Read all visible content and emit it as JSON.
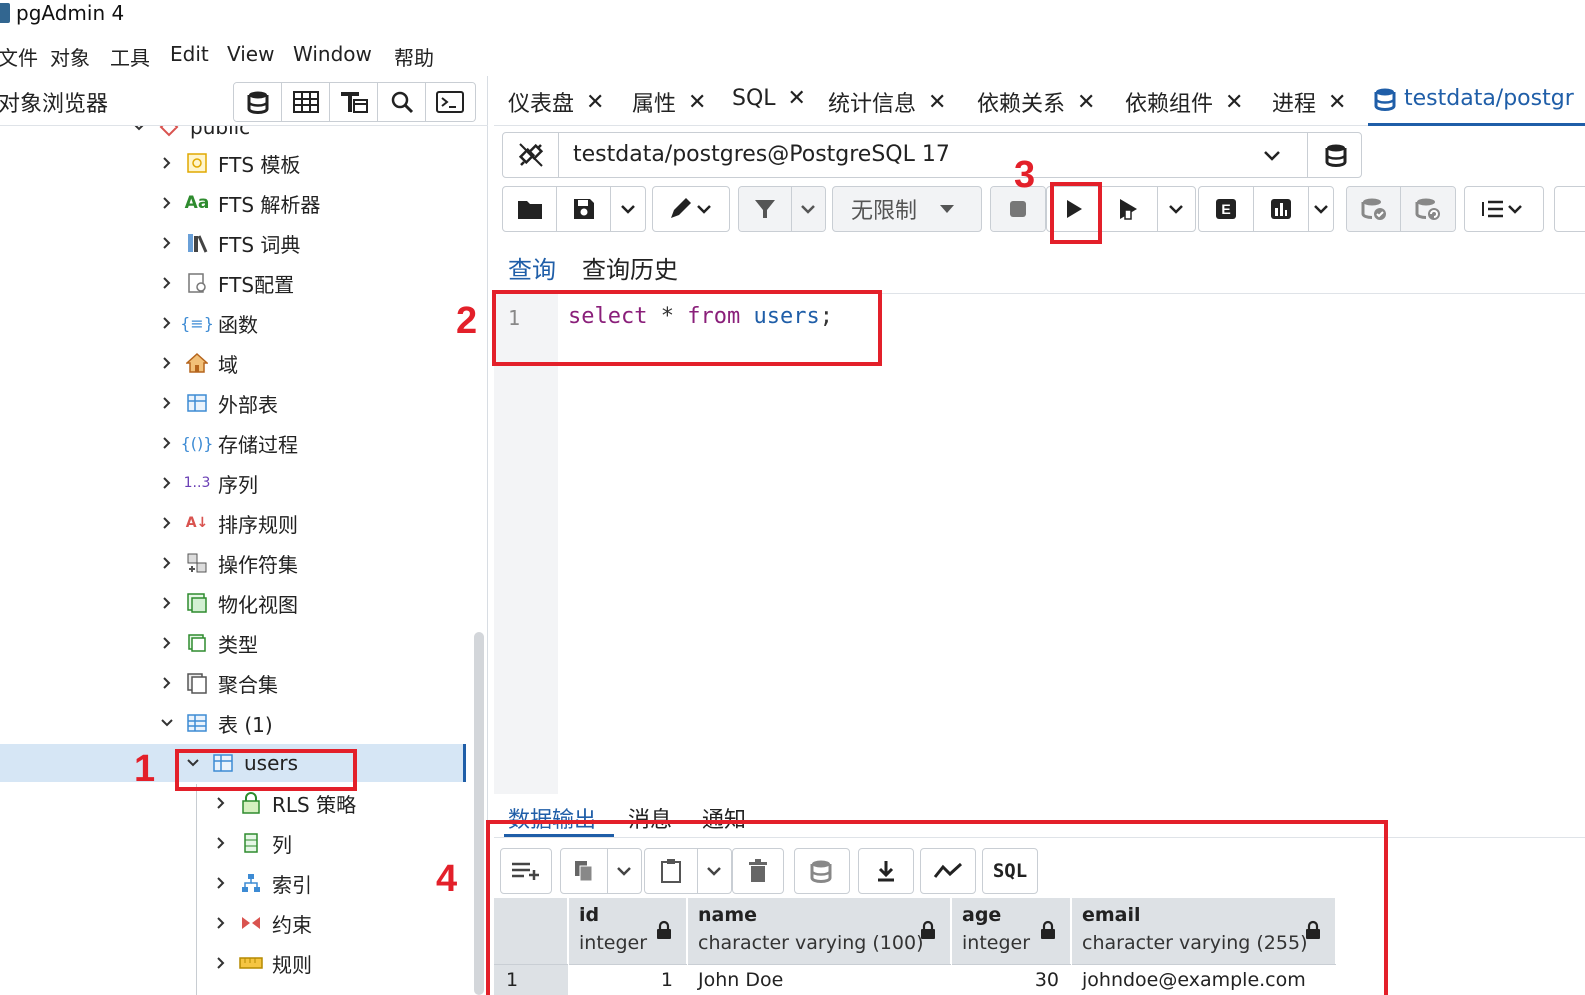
{
  "app": {
    "title": "pgAdmin 4"
  },
  "menu": [
    "文件",
    "对象",
    "工具",
    "Edit",
    "View",
    "Window",
    "帮助"
  ],
  "browser": {
    "title": "对象浏览器",
    "tools": [
      "database-icon",
      "table-icon",
      "query-tool-icon",
      "search-icon",
      "terminal-icon"
    ]
  },
  "tree": {
    "partial_top": "public",
    "items": [
      {
        "label": "FTS 模板",
        "icon": "fts-template-icon"
      },
      {
        "label": "FTS 解析器",
        "icon": "fts-parser-icon",
        "prefix": "Aa"
      },
      {
        "label": "FTS 词典",
        "icon": "fts-dictionary-icon"
      },
      {
        "label": "FTS配置",
        "icon": "fts-config-icon"
      },
      {
        "label": "函数",
        "icon": "function-icon"
      },
      {
        "label": "域",
        "icon": "domain-icon"
      },
      {
        "label": "外部表",
        "icon": "foreign-table-icon"
      },
      {
        "label": "存储过程",
        "icon": "procedure-icon"
      },
      {
        "label": "序列",
        "icon": "sequence-icon",
        "prefix": "1..3"
      },
      {
        "label": "排序规则",
        "icon": "collation-icon"
      },
      {
        "label": "操作符集",
        "icon": "operator-icon"
      },
      {
        "label": "物化视图",
        "icon": "mview-icon"
      },
      {
        "label": "类型",
        "icon": "type-icon"
      },
      {
        "label": "聚合集",
        "icon": "aggregate-icon"
      },
      {
        "label": "表 (1)",
        "icon": "tables-icon"
      }
    ],
    "selected": {
      "label": "users",
      "icon": "table-icon"
    },
    "children": [
      {
        "label": "RLS 策略",
        "icon": "rls-policy-icon"
      },
      {
        "label": "列",
        "icon": "columns-icon"
      },
      {
        "label": "索引",
        "icon": "index-icon"
      },
      {
        "label": "约束",
        "icon": "constraint-icon"
      },
      {
        "label": "规则",
        "icon": "rule-icon"
      }
    ]
  },
  "tabs": [
    "仪表盘",
    "属性",
    "SQL",
    "统计信息",
    "依赖关系",
    "依赖组件",
    "进程"
  ],
  "active_tab": "testdata/postgr",
  "connection": {
    "value": "testdata/postgres@PostgreSQL 17"
  },
  "toolbar": {
    "limit_label": "无限制"
  },
  "query_tabs": {
    "query": "查询",
    "history": "查询历史"
  },
  "editor": {
    "line_number": "1",
    "tokens": {
      "kw1": "select",
      "star": "*",
      "kw2": "from",
      "table": "users",
      "semi": ";"
    }
  },
  "output_tabs": {
    "data": "数据输出",
    "messages": "消息",
    "notifications": "通知"
  },
  "output_toolbar": {
    "sql_label": "SQL"
  },
  "grid": {
    "columns": [
      {
        "name": "id",
        "type": "integer"
      },
      {
        "name": "name",
        "type": "character varying (100)"
      },
      {
        "name": "age",
        "type": "integer"
      },
      {
        "name": "email",
        "type": "character varying (255)"
      }
    ],
    "rows": [
      {
        "rownum": "1",
        "id": "1",
        "name": "John Doe",
        "age": "30",
        "email": "johndoe@example.com"
      }
    ]
  },
  "annotations": {
    "n1": "1",
    "n2": "2",
    "n3": "3",
    "n4": "4",
    "color": "#e3202a"
  },
  "colors": {
    "accent": "#1f5ea8",
    "keyword": "#8a1f7a",
    "selection": "#d6e6f5"
  }
}
